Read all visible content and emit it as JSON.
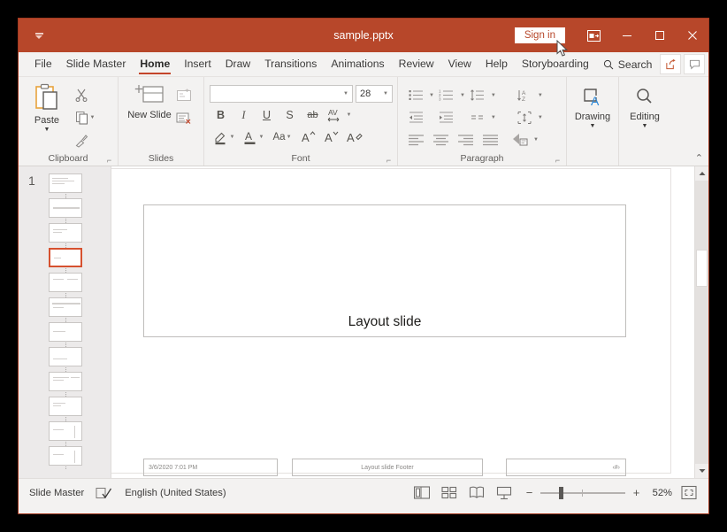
{
  "window": {
    "title": "sample.pptx",
    "signin_label": "Sign in",
    "qat_icon": "quick-access-toolbar-icon",
    "ribbon_display_icon": "ribbon-display-options-icon",
    "minimize_icon": "minimize-icon",
    "maximize_icon": "maximize-icon",
    "close_icon": "close-icon",
    "titlebar_color": "#b7472a",
    "accent_color": "#c4452a"
  },
  "tabs": [
    {
      "label": "File",
      "active": false
    },
    {
      "label": "Slide Master",
      "active": false
    },
    {
      "label": "Home",
      "active": true
    },
    {
      "label": "Insert",
      "active": false
    },
    {
      "label": "Draw",
      "active": false
    },
    {
      "label": "Transitions",
      "active": false
    },
    {
      "label": "Animations",
      "active": false
    },
    {
      "label": "Review",
      "active": false
    },
    {
      "label": "View",
      "active": false
    },
    {
      "label": "Help",
      "active": false
    },
    {
      "label": "Storyboarding",
      "active": false
    }
  ],
  "search": {
    "label": "Search",
    "icon": "search-icon"
  },
  "tab_right_buttons": [
    {
      "name": "share-button",
      "icon": "share-icon"
    },
    {
      "name": "comments-button",
      "icon": "comment-icon"
    }
  ],
  "ribbon": {
    "groups": [
      {
        "label": "Clipboard",
        "has_launcher": true,
        "big_button": {
          "label": "Paste",
          "icon": "paste-icon",
          "has_caret": true
        },
        "small_buttons": [
          {
            "name": "cut-button",
            "icon": "scissors-icon"
          },
          {
            "name": "copy-button",
            "icon": "copy-icon",
            "has_caret": true
          },
          {
            "name": "format-painter-button",
            "icon": "format-painter-icon"
          }
        ]
      },
      {
        "label": "Slides",
        "has_launcher": false,
        "big_button": {
          "label": "New Slide",
          "icon": "new-slide-icon",
          "has_caret": true
        },
        "small_buttons": [
          {
            "name": "insert-layout-button",
            "icon": "insert-layout-icon"
          },
          {
            "name": "delete-layout-button",
            "icon": "delete-layout-icon"
          }
        ]
      },
      {
        "label": "Font",
        "has_launcher": true
      },
      {
        "label": "Paragraph",
        "has_launcher": true
      },
      {
        "label": "Drawing",
        "has_launcher": false,
        "big_button": {
          "label": "Drawing",
          "icon": "drawing-shapes-icon",
          "has_caret": true
        }
      },
      {
        "label": "Editing",
        "has_launcher": false,
        "big_button": {
          "label": "Editing",
          "icon": "magnifier-icon",
          "has_caret": true
        }
      }
    ],
    "font": {
      "font_name_value": "",
      "font_size_value": "28",
      "row1": [
        {
          "name": "bold-button",
          "glyph": "B",
          "style": "bold"
        },
        {
          "name": "italic-button",
          "glyph": "I",
          "style": "italic"
        },
        {
          "name": "underline-button",
          "glyph": "U",
          "style": "underline"
        },
        {
          "name": "text-shadow-button",
          "glyph": "S",
          "style": "normal"
        },
        {
          "name": "strikethrough-button",
          "glyph": "ab",
          "style": "strike"
        },
        {
          "name": "character-spacing-button",
          "glyph": "AV",
          "style": "spacing"
        }
      ],
      "row2": [
        {
          "name": "text-highlight-color-button",
          "icon": "highlighter-icon",
          "has_caret": true
        },
        {
          "name": "font-color-button",
          "icon": "font-color-a-icon",
          "has_caret": true
        },
        {
          "name": "change-case-button",
          "icon": "change-case-icon",
          "has_caret": true
        },
        {
          "name": "increase-font-size-button",
          "icon": "increase-font-size-icon"
        },
        {
          "name": "decrease-font-size-button",
          "icon": "decrease-font-size-icon"
        },
        {
          "name": "clear-formatting-button",
          "icon": "clear-formatting-icon"
        }
      ]
    },
    "paragraph": {
      "row1": [
        {
          "name": "bullets-button",
          "icon": "bullet-list-icon",
          "has_caret": true
        },
        {
          "name": "numbering-button",
          "icon": "numbered-list-icon",
          "has_caret": true
        },
        {
          "name": "line-spacing-button",
          "icon": "line-spacing-icon",
          "has_caret": true
        },
        {
          "name": "text-direction-sort-button",
          "icon": "sort-icon",
          "has_caret": true
        }
      ],
      "row2": [
        {
          "name": "decrease-indent-button",
          "icon": "decrease-indent-icon"
        },
        {
          "name": "increase-indent-button",
          "icon": "increase-indent-icon"
        },
        {
          "name": "text-columns-button",
          "icon": "columns-icon",
          "has_caret": true
        },
        {
          "name": "align-text-button",
          "icon": "align-text-vertical-icon",
          "has_caret": true
        }
      ],
      "row3": [
        {
          "name": "align-left-button",
          "icon": "align-left-icon"
        },
        {
          "name": "align-center-button",
          "icon": "align-center-icon"
        },
        {
          "name": "align-right-button",
          "icon": "align-right-icon"
        },
        {
          "name": "justify-button",
          "icon": "justify-icon"
        },
        {
          "name": "convert-to-smartart-button",
          "icon": "smartart-icon",
          "has_caret": true
        }
      ]
    },
    "collapse_icon": "chevron-up-icon"
  },
  "thumbnails": {
    "master_number": "1",
    "selected_index": 4,
    "count": 12
  },
  "slide": {
    "title_placeholder_text": "Layout slide",
    "date_placeholder_text": "3/6/2020 7:01 PM",
    "footer_placeholder_text": "Layout slide Footer",
    "slide_number_placeholder_text": "‹#›"
  },
  "statusbar": {
    "view_name": "Slide Master",
    "spellcheck_icon": "spell-check-icon",
    "language": "English (United States)",
    "view_buttons": [
      {
        "name": "normal-view-button",
        "icon": "normal-view-icon"
      },
      {
        "name": "slide-sorter-view-button",
        "icon": "slide-sorter-icon"
      },
      {
        "name": "reading-view-button",
        "icon": "reading-view-icon"
      },
      {
        "name": "slide-show-button",
        "icon": "slide-show-icon"
      }
    ],
    "zoom_out_label": "−",
    "zoom_in_label": "+",
    "zoom_percent": "52%",
    "fit_icon": "fit-to-window-icon"
  }
}
